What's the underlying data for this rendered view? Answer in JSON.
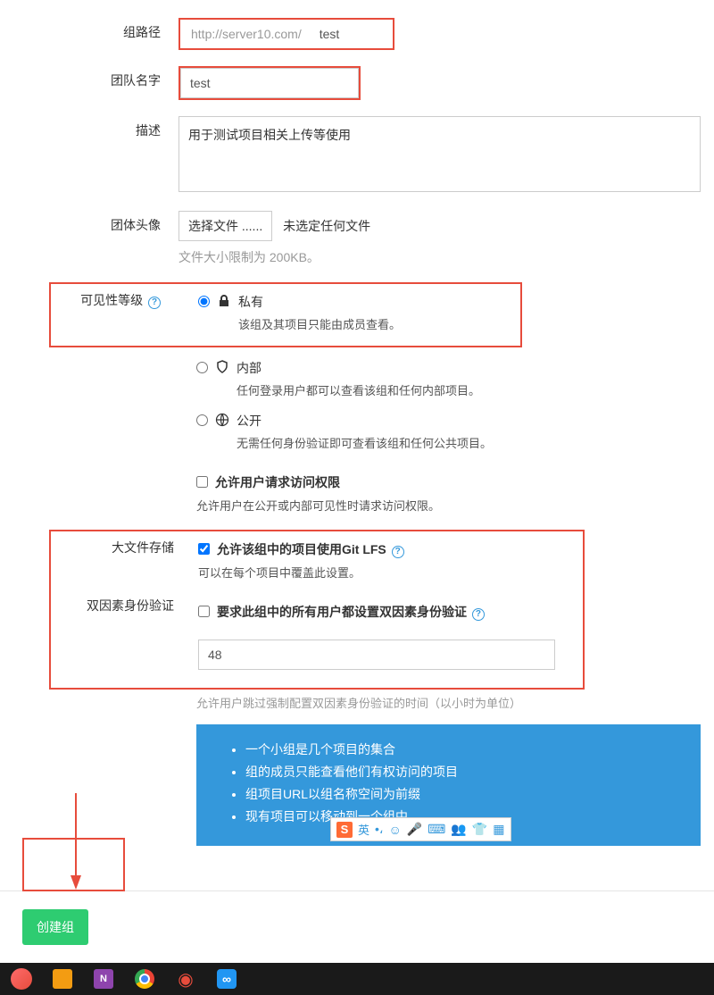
{
  "labels": {
    "group_path": "组路径",
    "team_name": "团队名字",
    "description": "描述",
    "avatar": "团体头像",
    "visibility": "可见性等级",
    "lfs": "大文件存储",
    "two_factor": "双因素身份验证"
  },
  "group_path": {
    "prefix": "http://server10.com/",
    "value": "test"
  },
  "team_name": {
    "value": "test"
  },
  "description": {
    "value": "用于测试项目相关上传等使用"
  },
  "avatar": {
    "button": "选择文件 ......",
    "no_file": "未选定任何文件",
    "hint": "文件大小限制为 200KB。"
  },
  "visibility": {
    "private": {
      "title": "私有",
      "desc": "该组及其项目只能由成员查看。"
    },
    "internal": {
      "title": "内部",
      "desc": "任何登录用户都可以查看该组和任何内部项目。"
    },
    "public": {
      "title": "公开",
      "desc": "无需任何身份验证即可查看该组和任何公共项目。"
    }
  },
  "access_request": {
    "label": "允许用户请求访问权限",
    "desc": "允许用户在公开或内部可见性时请求访问权限。"
  },
  "lfs": {
    "label": "允许该组中的项目使用Git LFS",
    "desc": "可以在每个项目中覆盖此设置。"
  },
  "two_factor": {
    "label": "要求此组中的所有用户都设置双因素身份验证",
    "hours_value": "48",
    "hint": "允许用户跳过强制配置双因素身份验证的时间（以小时为单位）"
  },
  "info_list": [
    "一个小组是几个项目的集合",
    "组的成员只能查看他们有权访问的项目",
    "组项目URL以组名称空间为前缀",
    "现有项目可以移动到一个组中"
  ],
  "ime": {
    "lang": "英"
  },
  "submit": "创建组"
}
